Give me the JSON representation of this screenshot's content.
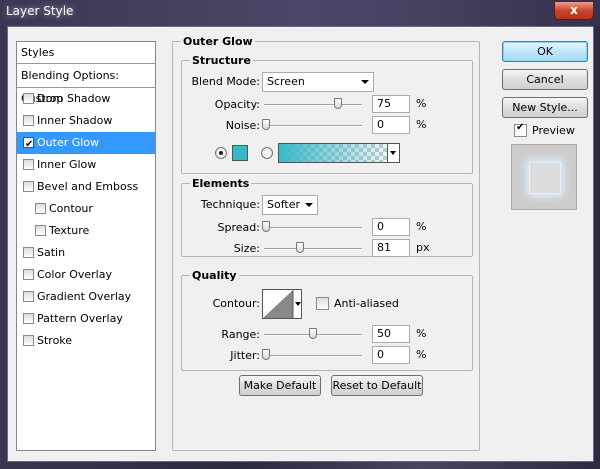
{
  "window": {
    "title": "Layer Style",
    "close_glyph": "x"
  },
  "styles_panel": {
    "header": "Styles",
    "blending": "Blending Options: Custom",
    "items": [
      {
        "label": "Drop Shadow",
        "checked": false,
        "sub": false,
        "active": false
      },
      {
        "label": "Inner Shadow",
        "checked": false,
        "sub": false,
        "active": false
      },
      {
        "label": "Outer Glow",
        "checked": true,
        "sub": false,
        "active": true
      },
      {
        "label": "Inner Glow",
        "checked": false,
        "sub": false,
        "active": false
      },
      {
        "label": "Bevel and Emboss",
        "checked": false,
        "sub": false,
        "active": false
      },
      {
        "label": "Contour",
        "checked": false,
        "sub": true,
        "active": false
      },
      {
        "label": "Texture",
        "checked": false,
        "sub": true,
        "active": false
      },
      {
        "label": "Satin",
        "checked": false,
        "sub": false,
        "active": false
      },
      {
        "label": "Color Overlay",
        "checked": false,
        "sub": false,
        "active": false
      },
      {
        "label": "Gradient Overlay",
        "checked": false,
        "sub": false,
        "active": false
      },
      {
        "label": "Pattern Overlay",
        "checked": false,
        "sub": false,
        "active": false
      },
      {
        "label": "Stroke",
        "checked": false,
        "sub": false,
        "active": false
      }
    ]
  },
  "outer_glow": {
    "title": "Outer Glow",
    "structure": {
      "title": "Structure",
      "blend_mode_label": "Blend Mode:",
      "blend_mode_value": "Screen",
      "opacity_label": "Opacity:",
      "opacity_value": "75",
      "opacity_unit": "%",
      "noise_label": "Noise:",
      "noise_value": "0",
      "noise_unit": "%",
      "glow_color": "#3bb8c8"
    },
    "elements": {
      "title": "Elements",
      "technique_label": "Technique:",
      "technique_value": "Softer",
      "spread_label": "Spread:",
      "spread_value": "0",
      "spread_unit": "%",
      "size_label": "Size:",
      "size_value": "81",
      "size_unit": "px"
    },
    "quality": {
      "title": "Quality",
      "contour_label": "Contour:",
      "anti_aliased_label": "Anti-aliased",
      "range_label": "Range:",
      "range_value": "50",
      "range_unit": "%",
      "jitter_label": "Jitter:",
      "jitter_value": "0",
      "jitter_unit": "%"
    },
    "make_default": "Make Default",
    "reset_default": "Reset to Default"
  },
  "actions": {
    "ok": "OK",
    "cancel": "Cancel",
    "new_style": "New Style...",
    "preview_label": "Preview",
    "preview_checked": true
  }
}
